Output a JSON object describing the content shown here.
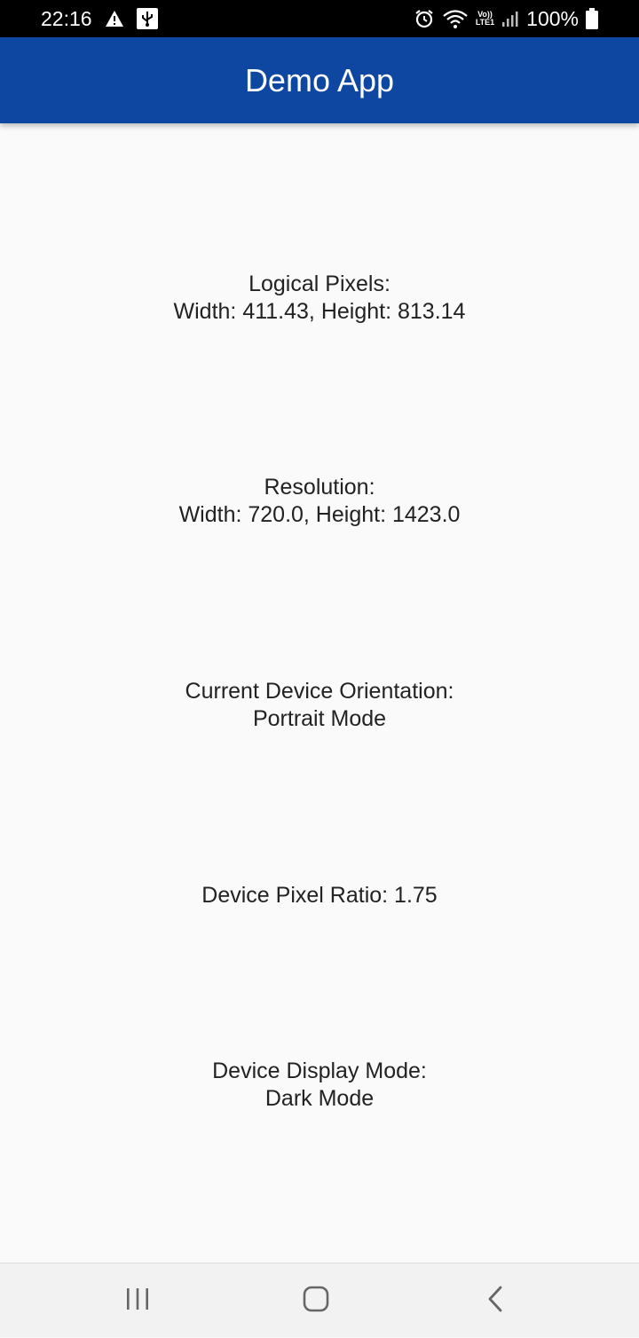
{
  "status_bar": {
    "time": "22:16",
    "battery": "100%",
    "network_top": "Vo))",
    "network_bottom": "LTE1"
  },
  "app_bar": {
    "title": "Demo App"
  },
  "info": {
    "logical_pixels_label": "Logical Pixels:",
    "logical_pixels_value": "Width: 411.43, Height: 813.14",
    "resolution_label": "Resolution:",
    "resolution_value": "Width: 720.0, Height: 1423.0",
    "orientation_label": "Current Device Orientation:",
    "orientation_value": "Portrait Mode",
    "pixel_ratio": "Device Pixel Ratio: 1.75",
    "display_mode_label": "Device Display Mode:",
    "display_mode_value": "Dark Mode"
  },
  "colors": {
    "app_bar": "#0d47a1",
    "background": "#fafafa",
    "text": "#222222"
  },
  "nav_bar": {
    "icons": [
      "recent-apps-icon",
      "home-icon",
      "back-icon"
    ]
  }
}
